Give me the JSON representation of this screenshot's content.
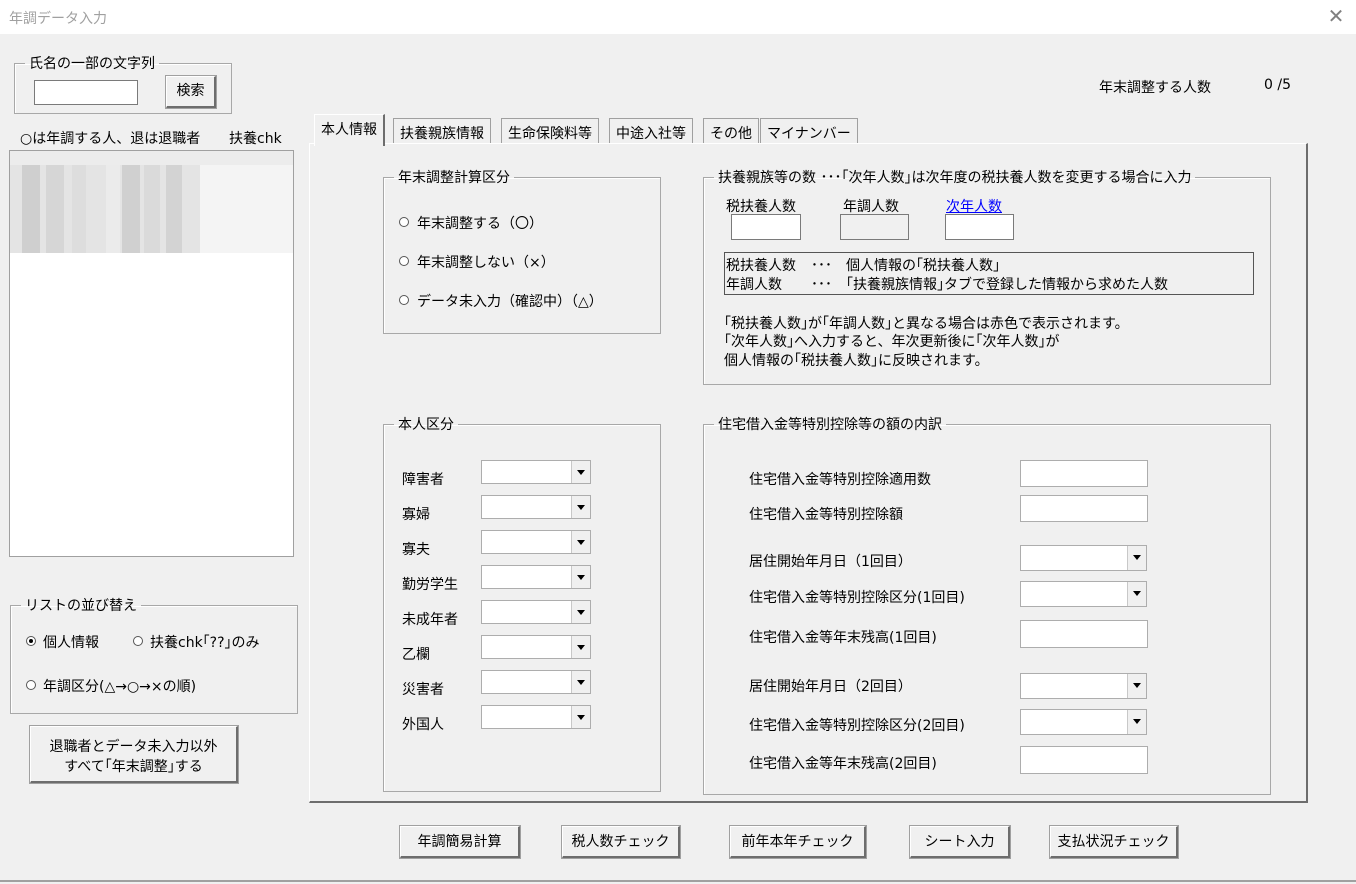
{
  "window": {
    "title": "年調データ入力"
  },
  "search": {
    "legend": "氏名の一部の文字列",
    "value": "",
    "button": "検索"
  },
  "header": {
    "count_label": "年末調整する人数",
    "count_value": "0 /5"
  },
  "list": {
    "header_left": "○は年調する人、退は退職者",
    "header_right": "扶養chk"
  },
  "sort": {
    "legend": "リストの並び替え",
    "options": [
      "個人情報",
      "扶養chk｢??｣のみ",
      "年調区分(△→○→×の順)"
    ],
    "selected": 0
  },
  "all_button": {
    "line1": "退職者とデータ未入力以外",
    "line2": "すべて｢年末調整｣する"
  },
  "tabs": [
    "本人情報",
    "扶養親族情報",
    "生命保険料等",
    "中途入社等",
    "その他",
    "マイナンバー"
  ],
  "active_tab": 0,
  "calc_group": {
    "legend": "年末調整計算区分",
    "options": [
      "年末調整する（〇）",
      "年末調整しない（×）",
      "データ未入力（確認中）（△）"
    ]
  },
  "dependents": {
    "legend": "扶養親族等の数 ･･･｢次年人数｣は次年度の税扶養人数を変更する場合に入力",
    "col1": "税扶養人数",
    "col2": "年調人数",
    "col3": "次年人数",
    "note1_label": "税扶養人数",
    "note1_sep": "･･･",
    "note1_text": "個人情報の｢税扶養人数｣",
    "note2_label": "年調人数",
    "note2_sep": "･･･",
    "note2_text": "｢扶養親族情報｣タブで登録した情報から求めた人数",
    "desc1": "｢税扶養人数｣が｢年調人数｣と異なる場合は赤色で表示されます。",
    "desc2": "｢次年人数｣へ入力すると、年次更新後に｢次年人数｣が",
    "desc3": "個人情報の｢税扶養人数｣に反映されます。",
    "link_color": "#0000ff"
  },
  "person": {
    "legend": "本人区分",
    "items": [
      "障害者",
      "寡婦",
      "寡夫",
      "勤労学生",
      "未成年者",
      "乙欄",
      "災害者",
      "外国人"
    ]
  },
  "housing": {
    "legend": "住宅借入金等特別控除等の額の内訳",
    "rows": [
      "住宅借入金等特別控除適用数",
      "住宅借入金等特別控除額",
      "居住開始年月日（1回目）",
      "住宅借入金等特別控除区分(1回目)",
      "住宅借入金等年末残高(1回目)",
      "居住開始年月日（2回目）",
      "住宅借入金等特別控除区分(2回目)",
      "住宅借入金等年末残高(2回目)"
    ]
  },
  "bottom_buttons": [
    "年調簡易計算",
    "税人数チェック",
    "前年本年チェック",
    "シート入力",
    "支払状況チェック"
  ]
}
